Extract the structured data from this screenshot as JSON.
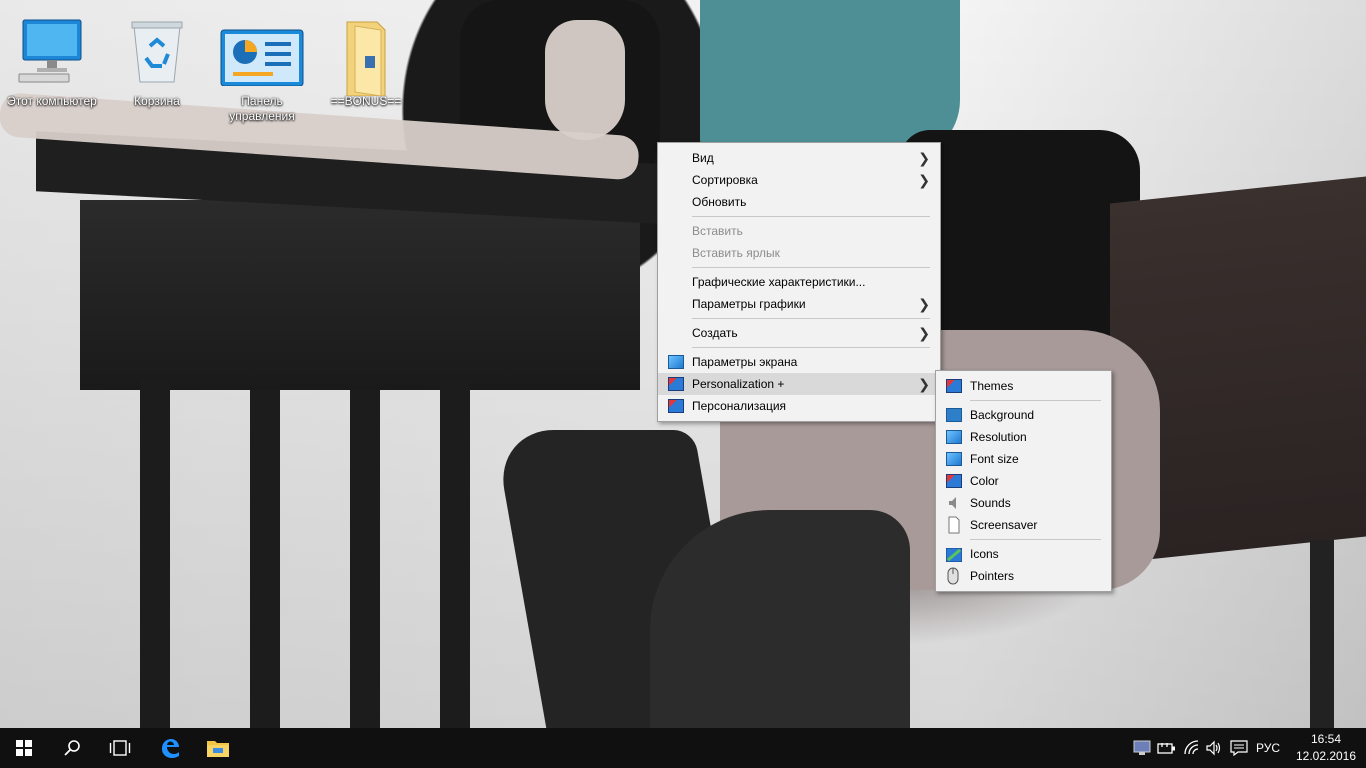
{
  "desktop": {
    "icons": [
      {
        "label": "Этот компьютер"
      },
      {
        "label": "Корзина"
      },
      {
        "label": "Панель управления"
      },
      {
        "label": "==BONUS=="
      }
    ]
  },
  "context_menu": {
    "items": {
      "view": "Вид",
      "sort": "Сортировка",
      "refresh": "Обновить",
      "paste": "Вставить",
      "paste_shortcut": "Вставить ярлык",
      "graphics_props": "Графические характеристики...",
      "graphics_options": "Параметры графики",
      "create": "Создать",
      "display_settings": "Параметры экрана",
      "personalization_plus": "Personalization +",
      "personalization": "Персонализация"
    }
  },
  "submenu": {
    "items": {
      "themes": "Themes",
      "background": "Background",
      "resolution": "Resolution",
      "font_size": "Font size",
      "color": "Color",
      "sounds": "Sounds",
      "screensaver": "Screensaver",
      "icons": "Icons",
      "pointers": "Pointers"
    }
  },
  "taskbar": {
    "language": "РУС",
    "time": "16:54",
    "date": "12.02.2016"
  },
  "colors": {
    "taskbar": "#101010",
    "menu_bg": "#f2f2f2",
    "menu_hover": "#d9d9d9",
    "edge_blue": "#1e90ff"
  }
}
